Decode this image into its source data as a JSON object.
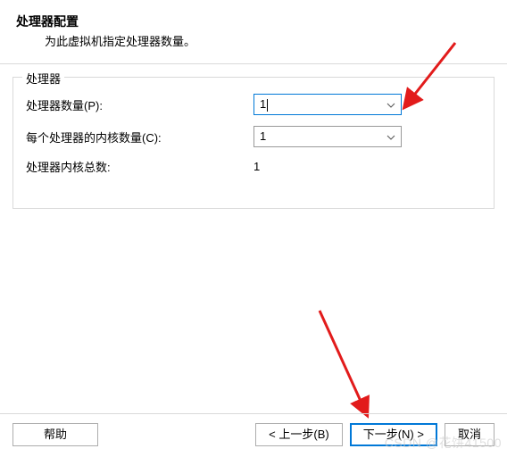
{
  "header": {
    "title": "处理器配置",
    "subtitle": "为此虚拟机指定处理器数量。"
  },
  "fieldset": {
    "legend": "处理器",
    "rows": {
      "processors": {
        "label": "处理器数量(P):",
        "value": "1"
      },
      "cores": {
        "label": "每个处理器的内核数量(C):",
        "value": "1"
      },
      "total": {
        "label": "处理器内核总数:",
        "value": "1"
      }
    }
  },
  "footer": {
    "help": "帮助",
    "back": "< 上一步(B)",
    "next": "下一步(N) >",
    "cancel": "取消"
  },
  "watermark": "CSDN @花饼41500"
}
